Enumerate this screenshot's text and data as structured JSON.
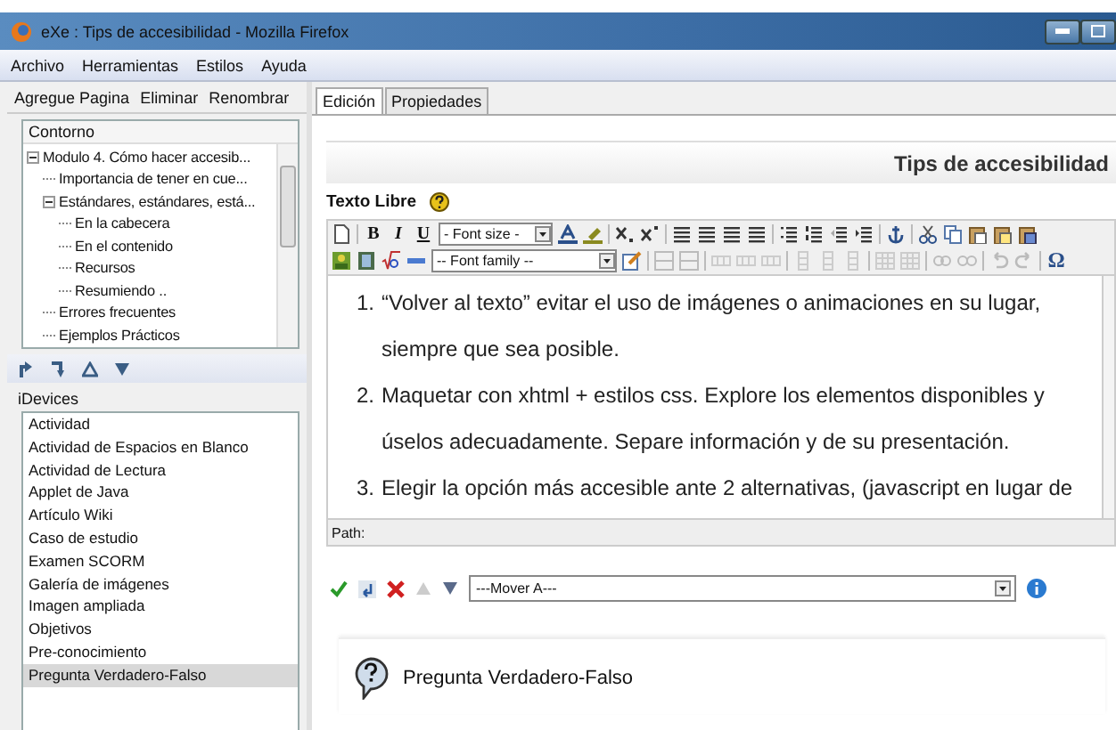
{
  "window": {
    "title": "eXe : Tips de accesibilidad - Mozilla Firefox"
  },
  "menu": [
    "Archivo",
    "Herramientas",
    "Estilos",
    "Ayuda"
  ],
  "outline_toolbar": [
    "Agregue Pagina",
    "Eliminar",
    "Renombrar"
  ],
  "outline": {
    "heading": "Contorno",
    "items": [
      {
        "label": "Modulo 4. Cómo hacer accesib...",
        "selected": false,
        "expanded": true,
        "children": [
          {
            "label": "Importancia de tener en cue...",
            "selected": false
          },
          {
            "label": "Estándares, estándares, está...",
            "selected": false,
            "expanded": true,
            "children": [
              {
                "label": "En la cabecera",
                "selected": false
              },
              {
                "label": "En el contenido",
                "selected": false
              },
              {
                "label": "Recursos",
                "selected": false
              },
              {
                "label": "Resumiendo ..",
                "selected": false
              }
            ]
          },
          {
            "label": "Errores frecuentes",
            "selected": false
          },
          {
            "label": "Ejemplos Prácticos",
            "selected": false
          }
        ]
      }
    ]
  },
  "idevices": {
    "heading": "iDevices",
    "items": [
      {
        "label": "Actividad",
        "selected": false
      },
      {
        "label": "Actividad de Espacios en Blanco",
        "selected": false
      },
      {
        "label": "Actividad de Lectura",
        "selected": false
      },
      {
        "label": "Applet de Java",
        "selected": false
      },
      {
        "label": "Artículo Wiki",
        "selected": false
      },
      {
        "label": "Caso de estudio",
        "selected": false
      },
      {
        "label": "Examen SCORM",
        "selected": false
      },
      {
        "label": "Galería de imágenes",
        "selected": false
      },
      {
        "label": "Imagen ampliada",
        "selected": false
      },
      {
        "label": "Objetivos",
        "selected": false
      },
      {
        "label": "Pre-conocimiento",
        "selected": false
      },
      {
        "label": "Pregunta Verdadero-Falso",
        "selected": true
      }
    ]
  },
  "tabs": [
    {
      "label": "Edición",
      "selected": true
    },
    {
      "label": "Propiedades",
      "selected": false
    }
  ],
  "page_title": "Tips de accesibilidad",
  "idevice_title": "Texto Libre",
  "editor": {
    "toolbar": {
      "font_size": "- Font size -",
      "font_family": "-- Font family --",
      "letters": [
        "B",
        "I",
        "U",
        "Ω"
      ]
    },
    "items": [
      {
        "marker": "1.",
        "text": "“Volver al texto” evitar el uso de imágenes o animaciones en su lugar, siempre que sea posible."
      },
      {
        "marker": "2.",
        "text": "Maquetar con xhtml + estilos css. Explore los elementos disponibles y úselos adecuadamente. Separe información y de su presentación."
      },
      {
        "marker": "3.",
        "text": "Elegir la opción más accesible ante 2 alternativas, (javascript en lugar de"
      }
    ],
    "path_label": "Path:"
  },
  "move_select": "---Mover A---",
  "next_idevice": "Pregunta Verdadero-Falso"
}
